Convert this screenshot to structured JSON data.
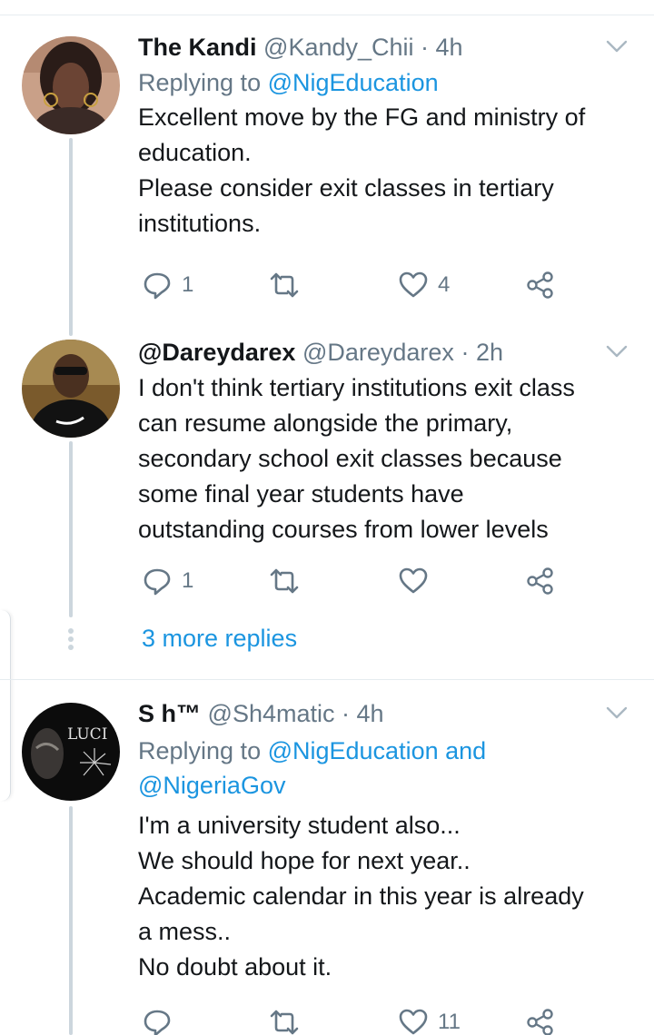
{
  "tweets": [
    {
      "display_name": "The Kandi",
      "handle": "@Kandy_Chii",
      "time": "· 4h",
      "replying_prefix": "Replying to ",
      "replying_to": "@NigEducation",
      "body_lines": [
        "Excellent move by the FG and ministry of",
        "education.",
        "Please consider exit classes in tertiary",
        "institutions."
      ],
      "reply_count": "1",
      "retweet_count": "",
      "like_count": "4"
    },
    {
      "display_name": "@Dareydarex",
      "handle": "@Dareydarex",
      "time": "· 2h",
      "body_lines": [
        "I don't think tertiary institutions exit class",
        "can resume alongside the primary,",
        "secondary school exit classes because",
        "some final year students have",
        "outstanding courses from lower levels"
      ],
      "reply_count": "1",
      "retweet_count": "",
      "like_count": ""
    },
    {
      "display_name": "S h™",
      "handle": "@Sh4matic",
      "time": "· 4h",
      "replying_prefix": "Replying to ",
      "replying_to": "@NigEducation and",
      "replying_to_line2": "@NigeriaGov",
      "avatar_text": "LUCI",
      "body_lines": [
        "I'm a university student also...",
        "We should hope for next year..",
        "Academic calendar in this year is already",
        "a mess..",
        "No doubt about it."
      ],
      "reply_count": "",
      "retweet_count": "",
      "like_count": "11"
    }
  ],
  "more_replies": "3 more replies",
  "colors": {
    "link": "#1b95e0",
    "secondary": "#657786",
    "thread_line": "#ccd6dd",
    "text": "#14171a"
  },
  "icons": {
    "reply": "reply-icon",
    "retweet": "retweet-icon",
    "like": "heart-icon",
    "share": "share-icon",
    "menu": "chevron-down-icon"
  }
}
